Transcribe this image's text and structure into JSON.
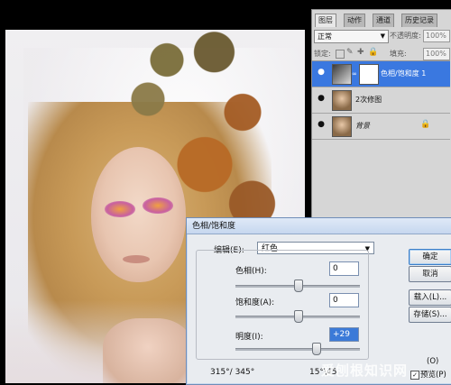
{
  "layers_panel": {
    "tabs": [
      "图层",
      "动作",
      "通道",
      "历史记录"
    ],
    "blend_mode": "正常",
    "opacity_label": "不透明度:",
    "opacity_value": "100%",
    "lock_label": "锁定:",
    "fill_label": "填充:",
    "fill_value": "100%",
    "layers": [
      {
        "name": "色相/饱和度 1",
        "selected": true
      },
      {
        "name": "2次修图",
        "selected": false
      },
      {
        "name": "背景",
        "selected": false
      }
    ]
  },
  "dialog": {
    "title": "色相/饱和度",
    "edit_label": "编辑(E):",
    "edit_value": "红色",
    "hue_label": "色相(H):",
    "hue_value": "0",
    "hue_level": 0.5,
    "saturation_label": "饱和度(A):",
    "saturation_value": "0",
    "saturation_level": 0.5,
    "lightness_label": "明度(I):",
    "lightness_value": "+29",
    "lightness_level": 0.645,
    "range_left": "315°/ 345°",
    "range_right": "15°\\45",
    "buttons": {
      "ok": "确定",
      "cancel": "取消",
      "load": "载入(L)...",
      "save": "存储(S)...",
      "colorize": "(O)",
      "preview": "预览(P)"
    }
  },
  "watermark": "爱刨根知识网"
}
